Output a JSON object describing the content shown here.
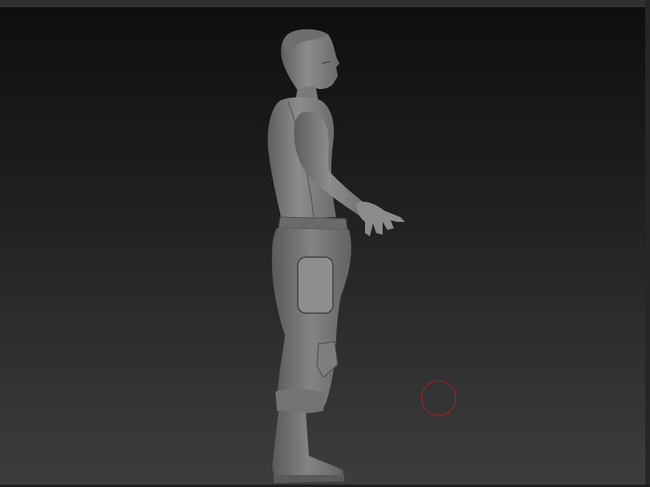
{
  "app": {
    "accent_color": "#b51e1e",
    "background_top": "#0f0f0f",
    "background_bottom": "#3d3d3d"
  },
  "viewport": {
    "model": {
      "icon": "sculpted-character-figure",
      "material_color": "#8a8a8a"
    },
    "brush_cursor": {
      "icon": "brush-circle-cursor"
    }
  }
}
